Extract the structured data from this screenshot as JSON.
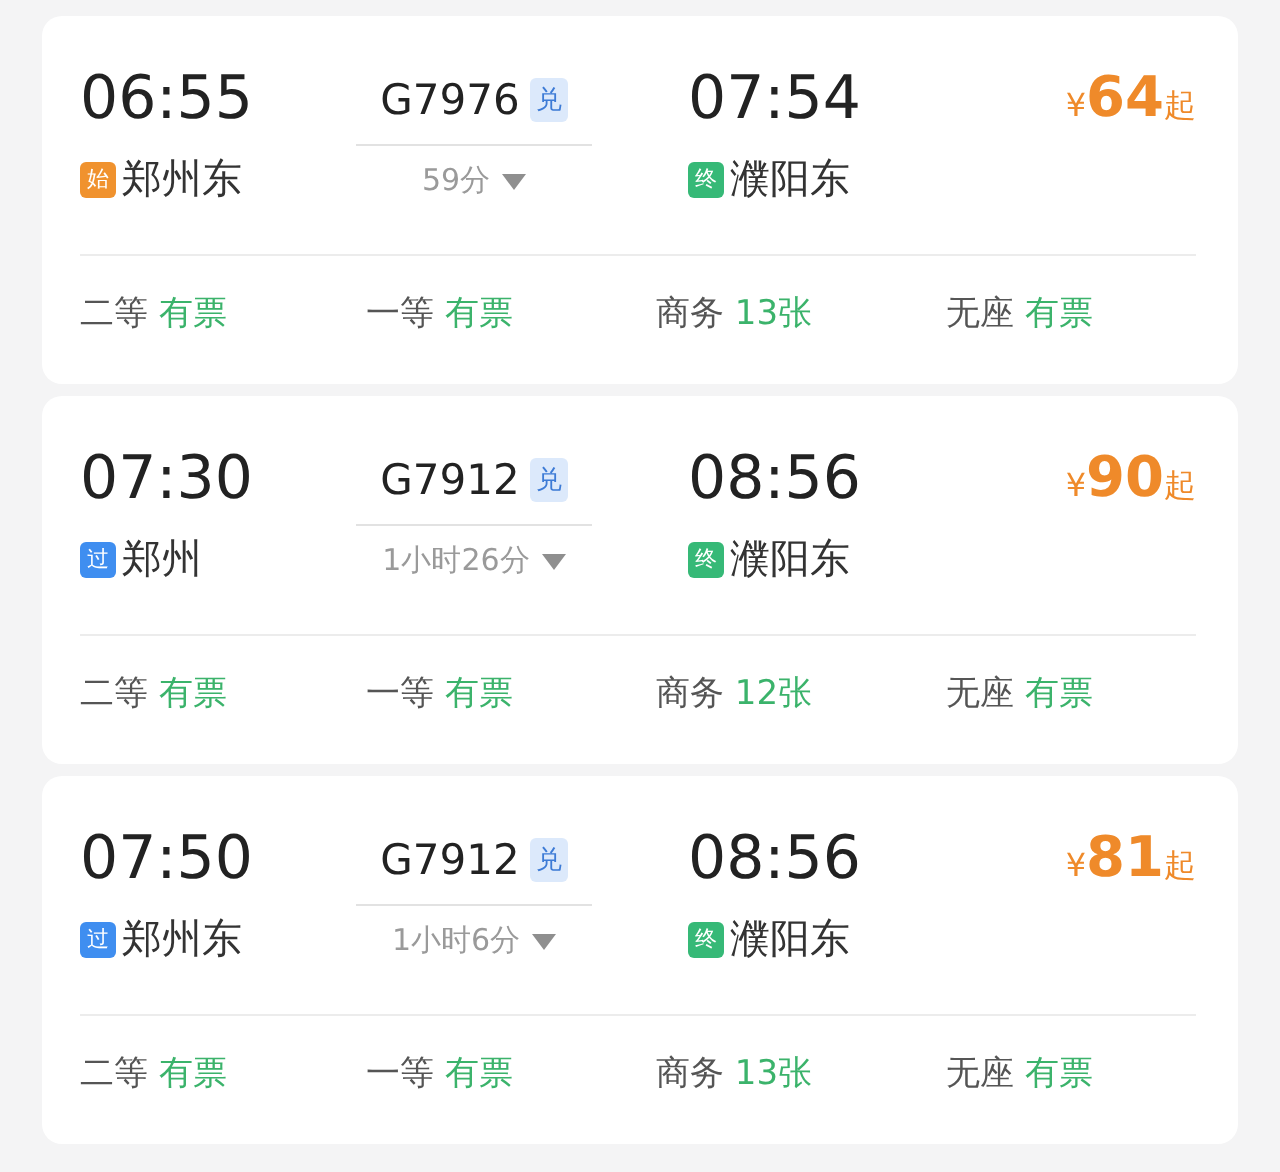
{
  "trains": [
    {
      "depart_time": "06:55",
      "depart_station": {
        "badge": "始",
        "kind": "start",
        "name": "郑州东"
      },
      "train_no": "G7976",
      "train_tag": "兑",
      "duration": "59分",
      "arrive_time": "07:54",
      "arrive_station": {
        "badge": "终",
        "kind": "end",
        "name": "濮阳东"
      },
      "price": {
        "currency": "¥",
        "amount": "64",
        "suffix": "起"
      },
      "seats": [
        {
          "class": "二等",
          "availability": "有票"
        },
        {
          "class": "一等",
          "availability": "有票"
        },
        {
          "class": "商务",
          "availability": "13张"
        },
        {
          "class": "无座",
          "availability": "有票"
        }
      ]
    },
    {
      "depart_time": "07:30",
      "depart_station": {
        "badge": "过",
        "kind": "pass",
        "name": "郑州"
      },
      "train_no": "G7912",
      "train_tag": "兑",
      "duration": "1小时26分",
      "arrive_time": "08:56",
      "arrive_station": {
        "badge": "终",
        "kind": "end",
        "name": "濮阳东"
      },
      "price": {
        "currency": "¥",
        "amount": "90",
        "suffix": "起"
      },
      "seats": [
        {
          "class": "二等",
          "availability": "有票"
        },
        {
          "class": "一等",
          "availability": "有票"
        },
        {
          "class": "商务",
          "availability": "12张"
        },
        {
          "class": "无座",
          "availability": "有票"
        }
      ]
    },
    {
      "depart_time": "07:50",
      "depart_station": {
        "badge": "过",
        "kind": "pass",
        "name": "郑州东"
      },
      "train_no": "G7912",
      "train_tag": "兑",
      "duration": "1小时6分",
      "arrive_time": "08:56",
      "arrive_station": {
        "badge": "终",
        "kind": "end",
        "name": "濮阳东"
      },
      "price": {
        "currency": "¥",
        "amount": "81",
        "suffix": "起"
      },
      "seats": [
        {
          "class": "二等",
          "availability": "有票"
        },
        {
          "class": "一等",
          "availability": "有票"
        },
        {
          "class": "商务",
          "availability": "13张"
        },
        {
          "class": "无座",
          "availability": "有票"
        }
      ]
    }
  ]
}
